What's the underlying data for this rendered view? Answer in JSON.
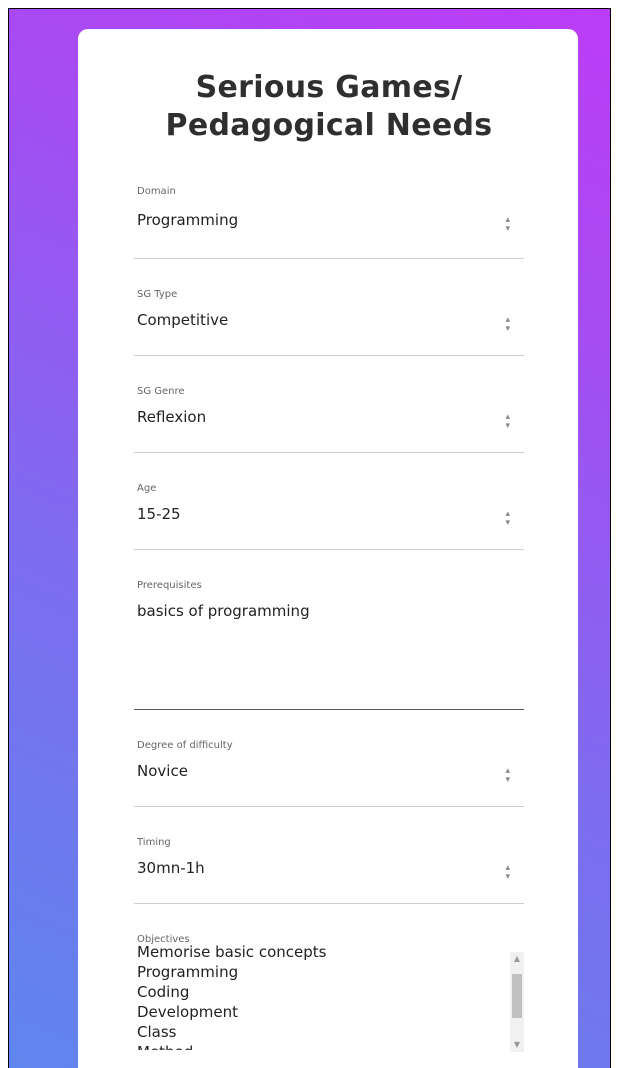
{
  "title": {
    "line1": "Serious Games/",
    "line2": "Pedagogical Needs"
  },
  "fields": [
    {
      "label": "Domain",
      "value": "Programming"
    },
    {
      "label": "SG Type",
      "value": "Competitive"
    },
    {
      "label": "SG Genre",
      "value": "Reflexion"
    },
    {
      "label": "Age",
      "value": "15-25"
    }
  ],
  "prerequisites": {
    "label": "Prerequisites",
    "value": "basics of programming"
  },
  "fields2": [
    {
      "label": "Degree of difficulty",
      "value": "Novice"
    },
    {
      "label": "Timing",
      "value": "30mn-1h"
    }
  ],
  "objectives": {
    "label": "Objectives",
    "items": [
      "Memorise basic concepts",
      "Programming",
      "Coding",
      "Development",
      "Class",
      "Method"
    ]
  },
  "icons": {
    "select_arrow": "updown-arrows-icon",
    "scroll_up": "chevron-up-icon",
    "scroll_down": "chevron-down-icon"
  },
  "colors": {
    "gradient_start": "#5f86ee",
    "gradient_end": "#bc3cf6"
  }
}
